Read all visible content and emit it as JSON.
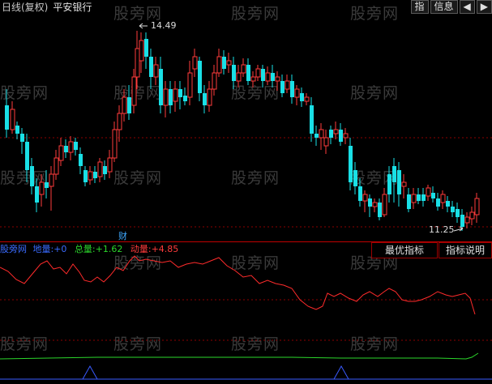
{
  "header": {
    "period": "日线(复权)",
    "stock_name": "平安银行",
    "buttons": [
      "指",
      "信息"
    ],
    "arrows": [
      "◀",
      "▶"
    ]
  },
  "price_chart": {
    "high_label": "14.49",
    "low_label": "11.25",
    "event_marker": "财"
  },
  "indicator": {
    "name": "股旁网",
    "items": [
      {
        "label": "地量:",
        "value": "+0",
        "color": "#3a6bff"
      },
      {
        "label": "总量:",
        "value": "+1.62",
        "color": "#2bd72b"
      },
      {
        "label": "动量:",
        "value": "+4.85",
        "color": "#ff3b3b"
      }
    ],
    "buttons": [
      "最优指标",
      "指标说明"
    ]
  },
  "watermark": "股旁网",
  "colors": {
    "up": "#ff3b3b",
    "down": "#19e0e6",
    "grid": "#8b0000"
  }
}
